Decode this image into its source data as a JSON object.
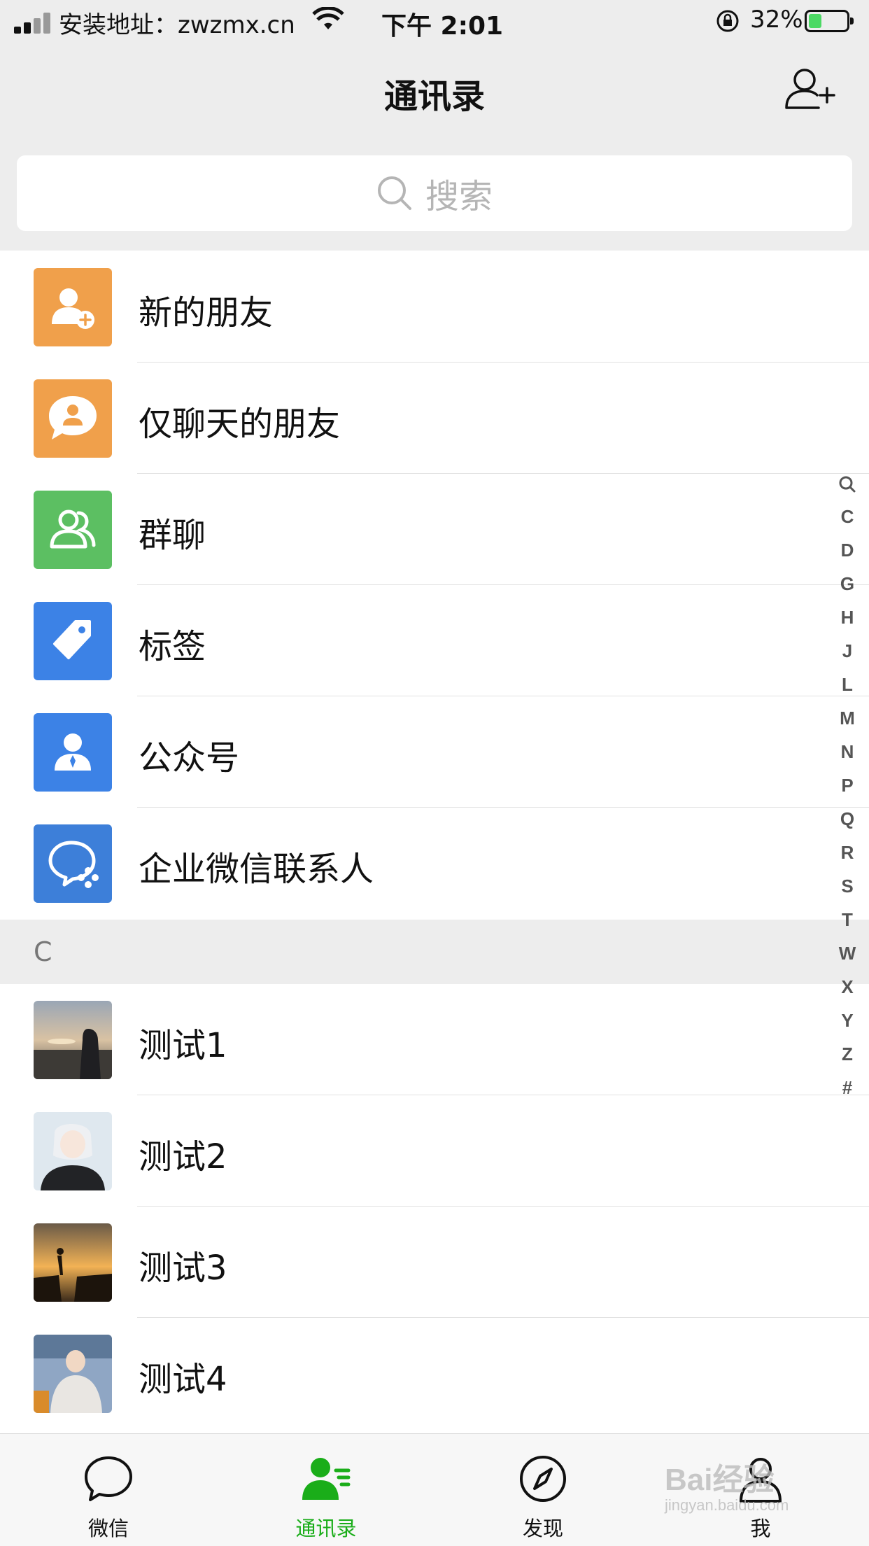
{
  "status_bar": {
    "carrier": "安装地址：zwzmx.cn",
    "time": "下午 2:01",
    "battery_pct": "32%"
  },
  "header": {
    "title": "通讯录",
    "add_icon": "add-contact-icon"
  },
  "search": {
    "placeholder": "搜索"
  },
  "functions": [
    {
      "label": "新的朋友",
      "icon": "new-friend-icon",
      "color": "#f0a04b"
    },
    {
      "label": "仅聊天的朋友",
      "icon": "chat-only-icon",
      "color": "#f0a04b"
    },
    {
      "label": "群聊",
      "icon": "group-chat-icon",
      "color": "#5cbf62"
    },
    {
      "label": "标签",
      "icon": "tag-icon",
      "color": "#3c82e6"
    },
    {
      "label": "公众号",
      "icon": "official-account-icon",
      "color": "#3c82e6"
    },
    {
      "label": "企业微信联系人",
      "icon": "wecom-icon",
      "color": "#3d7fd9"
    }
  ],
  "section_header": "C",
  "contacts": [
    {
      "name": "测试1"
    },
    {
      "name": "测试2"
    },
    {
      "name": "测试3"
    },
    {
      "name": "测试4"
    }
  ],
  "index_letters": [
    "Q",
    "C",
    "D",
    "G",
    "H",
    "J",
    "L",
    "M",
    "N",
    "P",
    "Q",
    "R",
    "S",
    "T",
    "W",
    "X",
    "Y",
    "Z",
    "#"
  ],
  "tabs": [
    {
      "label": "微信",
      "icon": "chat-bubble-icon",
      "active": false
    },
    {
      "label": "通讯录",
      "icon": "contacts-icon",
      "active": true
    },
    {
      "label": "发现",
      "icon": "compass-icon",
      "active": false
    },
    {
      "label": "我",
      "icon": "me-icon",
      "active": false
    }
  ],
  "colors": {
    "accent": "#1aad19",
    "header_bg": "#ededed"
  },
  "watermark": {
    "brand": "Bai经验",
    "url": "jingyan.baidu.com"
  }
}
